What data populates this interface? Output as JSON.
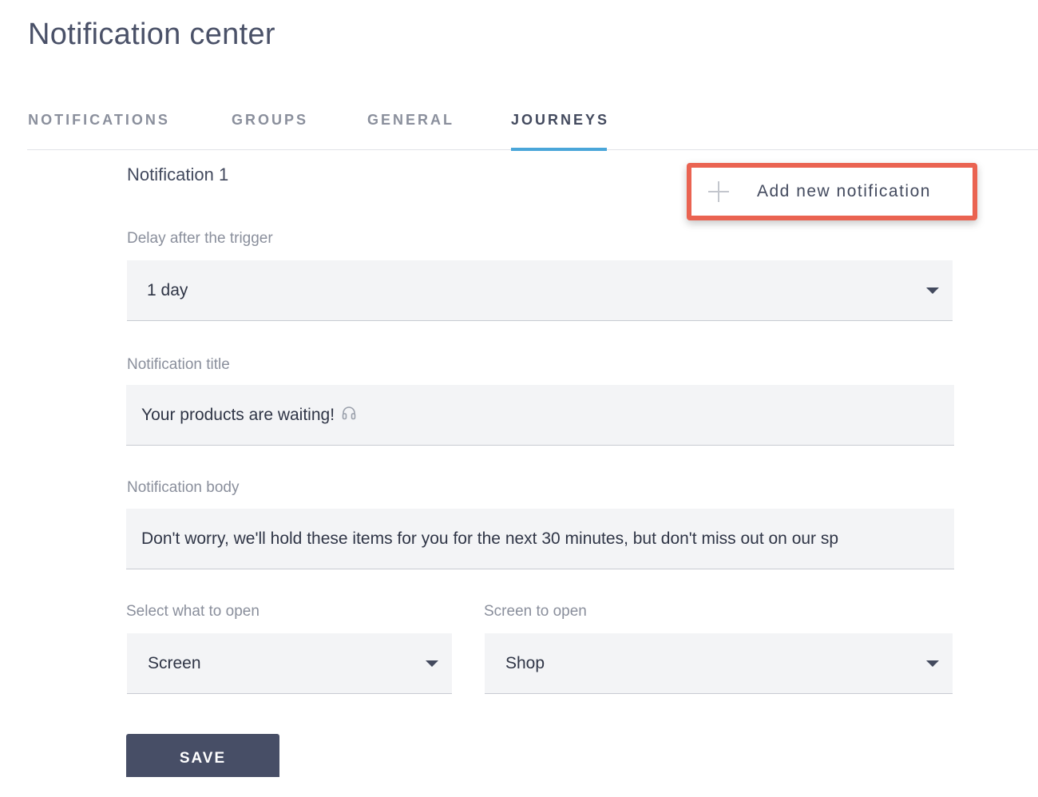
{
  "page_title": "Notification center",
  "tabs": [
    {
      "label": "NOTIFICATIONS",
      "active": false
    },
    {
      "label": "GROUPS",
      "active": false
    },
    {
      "label": "GENERAL",
      "active": false
    },
    {
      "label": "JOURNEYS",
      "active": true
    }
  ],
  "section_title": "Notification 1",
  "add_button": {
    "label": "Add new notification",
    "icon": "plus-icon",
    "highlight_color": "#ea6351"
  },
  "fields": {
    "delay": {
      "label": "Delay after the trigger",
      "value": "1 day"
    },
    "title": {
      "label": "Notification title",
      "value": "Your products are waiting!",
      "icon": "headphones-icon"
    },
    "body": {
      "label": "Notification body",
      "value": "Don't worry, we'll hold these items for you for the next 30 minutes, but don't miss out on our sp"
    },
    "open_type": {
      "label": "Select what to open",
      "value": "Screen"
    },
    "screen": {
      "label": "Screen to open",
      "value": "Shop"
    }
  },
  "save_button": {
    "label": "SAVE"
  },
  "colors": {
    "accent_tab": "#4aa6d9",
    "primary_button": "#474e66",
    "field_bg": "#f3f4f6"
  }
}
